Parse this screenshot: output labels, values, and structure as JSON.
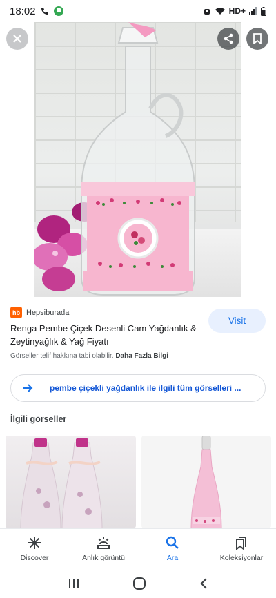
{
  "status_bar": {
    "time": "18:02",
    "network": "HD+"
  },
  "result": {
    "source": "Hepsiburada",
    "source_logo_text": "hb",
    "title": "Renga Pembe Çiçek Desenli Cam Yağdanlık & Zeytinyağlık & Yağ Fiyatı",
    "visit_label": "Visit",
    "license_text": "Görseller telif hakkına tabi olabilir.",
    "license_link": "Daha Fazla Bilgi",
    "all_images_label": "pembe çiçekli yağdanlık ile ilgili tüm görselleri ...",
    "related_heading": "İlgili görseller"
  },
  "bottom_nav": {
    "items": [
      {
        "label": "Discover",
        "icon": "asterisk-icon"
      },
      {
        "label": "Anlık görüntü",
        "icon": "snapshot-icon"
      },
      {
        "label": "Ara",
        "icon": "search-icon"
      },
      {
        "label": "Koleksiyonlar",
        "icon": "collections-icon"
      }
    ],
    "active_index": 2
  },
  "colors": {
    "accent": "#1a73e8",
    "visit_bg": "#e8f0fe",
    "hb_brand": "#ff6000"
  }
}
